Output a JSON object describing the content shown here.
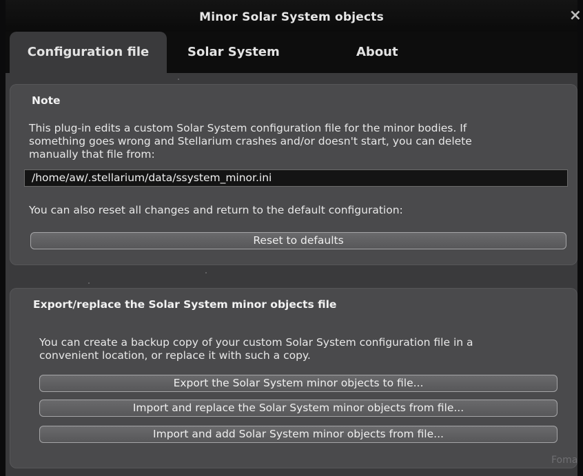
{
  "window": {
    "title": "Minor Solar System objects",
    "close_label": "×"
  },
  "tabs": [
    {
      "label": "Configuration file",
      "active": true
    },
    {
      "label": "Solar System",
      "active": false
    },
    {
      "label": "About",
      "active": false
    }
  ],
  "note": {
    "heading": "Note",
    "line1": "This plug-in edits a custom Solar System configuration file for the minor bodies. If",
    "line2": "something goes wrong and Stellarium crashes and/or doesn't start, you can delete",
    "line3": "manually that file from:",
    "path": "/home/aw/.stellarium/data/ssystem_minor.ini",
    "reset_text": "You can also reset all changes and return to the default configuration:",
    "reset_button": "Reset to defaults"
  },
  "export": {
    "heading": "Export/replace the Solar System minor objects file",
    "line1": "You can create a backup copy of your custom Solar System configuration file in a",
    "line2": "convenient location, or replace it with such a copy.",
    "export_button": "Export the Solar System minor objects to file...",
    "import_replace_button": "Import and replace the Solar System minor objects from file...",
    "import_add_button": "Import and add Solar System minor objects from file..."
  },
  "background": {
    "partial_text": "Foma"
  },
  "colors": {
    "window_bg": "#3a3a3c",
    "panel_bg": "#4a4a4c",
    "titlebar_bg": "#0d0d0d"
  }
}
